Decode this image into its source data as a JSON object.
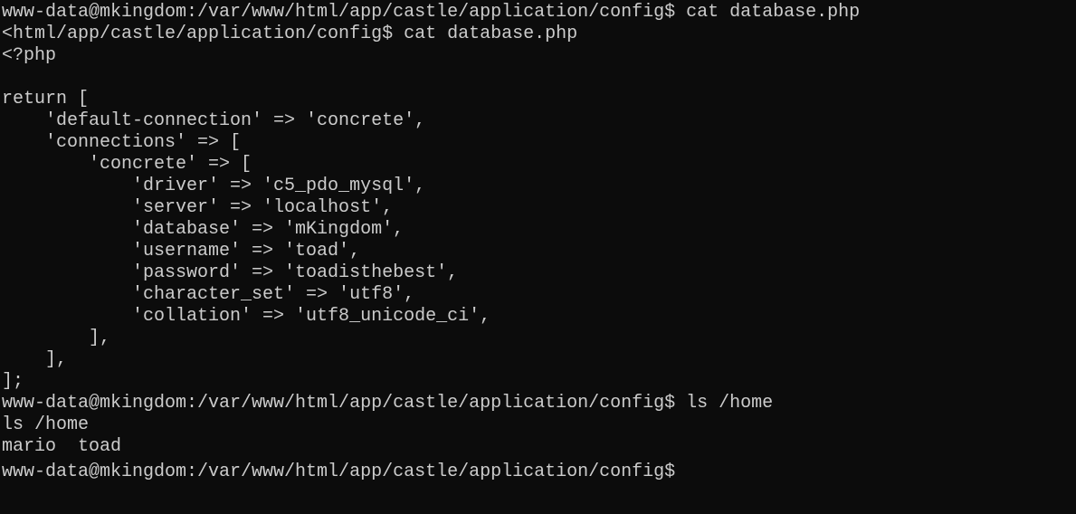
{
  "terminal": {
    "lines": [
      "www-data@mkingdom:/var/www/html/app/castle/application/config$ cat database.php",
      "<html/app/castle/application/config$ cat database.php",
      "<?php",
      "",
      "return [",
      "    'default-connection' => 'concrete',",
      "    'connections' => [",
      "        'concrete' => [",
      "            'driver' => 'c5_pdo_mysql',",
      "            'server' => 'localhost',",
      "            'database' => 'mKingdom',",
      "            'username' => 'toad',",
      "            'password' => 'toadisthebest',",
      "            'character_set' => 'utf8',",
      "            'collation' => 'utf8_unicode_ci',",
      "        ],",
      "    ],",
      "];",
      "www-data@mkingdom:/var/www/html/app/castle/application/config$ ls /home",
      "ls /home",
      "mario  toad",
      "www-data@mkingdom:/var/www/html/app/castle/application/config$ "
    ]
  }
}
